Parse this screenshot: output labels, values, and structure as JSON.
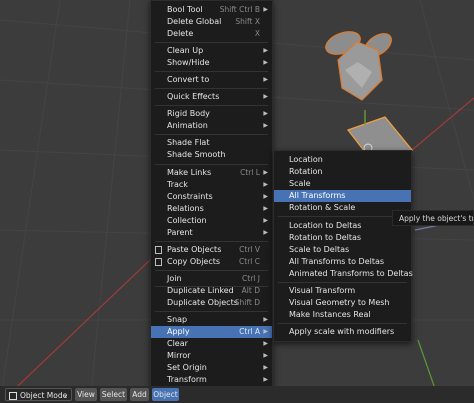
{
  "menu": {
    "items": [
      {
        "label": "Bool Tool",
        "shortcut": "Shift Ctrl B",
        "arrow": "▶"
      },
      {
        "label": "Delete Global",
        "shortcut": "Shift X",
        "arrow": ""
      },
      {
        "label": "Delete",
        "shortcut": "X",
        "arrow": ""
      },
      {
        "label": "Clean Up",
        "shortcut": "",
        "arrow": "▶"
      },
      {
        "label": "Show/Hide",
        "shortcut": "",
        "arrow": "▶"
      },
      {
        "label": "Convert to",
        "shortcut": "",
        "arrow": "▶"
      },
      {
        "label": "Quick Effects",
        "shortcut": "",
        "arrow": "▶"
      },
      {
        "label": "Rigid Body",
        "shortcut": "",
        "arrow": "▶"
      },
      {
        "label": "Animation",
        "shortcut": "",
        "arrow": "▶"
      },
      {
        "label": "Shade Flat",
        "shortcut": "",
        "arrow": ""
      },
      {
        "label": "Shade Smooth",
        "shortcut": "",
        "arrow": ""
      },
      {
        "label": "Make Links",
        "shortcut": "Ctrl L",
        "arrow": "▶"
      },
      {
        "label": "Track",
        "shortcut": "",
        "arrow": "▶"
      },
      {
        "label": "Constraints",
        "shortcut": "",
        "arrow": "▶"
      },
      {
        "label": "Relations",
        "shortcut": "",
        "arrow": "▶"
      },
      {
        "label": "Collection",
        "shortcut": "",
        "arrow": "▶"
      },
      {
        "label": "Parent",
        "shortcut": "",
        "arrow": "▶"
      },
      {
        "label": "Paste Objects",
        "shortcut": "Ctrl V",
        "arrow": ""
      },
      {
        "label": "Copy Objects",
        "shortcut": "Ctrl C",
        "arrow": ""
      },
      {
        "label": "Join",
        "shortcut": "Ctrl J",
        "arrow": ""
      },
      {
        "label": "Duplicate Linked",
        "shortcut": "Alt D",
        "arrow": ""
      },
      {
        "label": "Duplicate Objects",
        "shortcut": "Shift D",
        "arrow": ""
      },
      {
        "label": "Snap",
        "shortcut": "",
        "arrow": "▶"
      },
      {
        "label": "Apply",
        "shortcut": "Ctrl A",
        "arrow": "▶"
      },
      {
        "label": "Clear",
        "shortcut": "",
        "arrow": "▶"
      },
      {
        "label": "Mirror",
        "shortcut": "",
        "arrow": "▶"
      },
      {
        "label": "Set Origin",
        "shortcut": "",
        "arrow": "▶"
      },
      {
        "label": "Transform",
        "shortcut": "",
        "arrow": "▶"
      }
    ]
  },
  "apply_submenu": {
    "items": [
      {
        "label": "Location"
      },
      {
        "label": "Rotation"
      },
      {
        "label": "Scale"
      },
      {
        "label": "All Transforms"
      },
      {
        "label": "Rotation & Scale"
      },
      {
        "label": "Location to Deltas"
      },
      {
        "label": "Rotation to Deltas"
      },
      {
        "label": "Scale to Deltas"
      },
      {
        "label": "All Transforms to Deltas"
      },
      {
        "label": "Animated Transforms to Deltas"
      },
      {
        "label": "Visual Transform"
      },
      {
        "label": "Visual Geometry to Mesh"
      },
      {
        "label": "Make Instances Real"
      },
      {
        "label": "Apply scale with modifiers"
      }
    ],
    "highlighted": "All Transforms"
  },
  "tooltip": {
    "text": "Apply the object's trans"
  },
  "header": {
    "mode": "Object Mode",
    "menus": [
      "View",
      "Select",
      "Add",
      "Object"
    ],
    "active_menu": "Object"
  },
  "colors": {
    "accent": "#4772b3",
    "selection_outline": "#e07a2c",
    "x_axis": "#c8423d",
    "y_axis": "#6aa336"
  }
}
